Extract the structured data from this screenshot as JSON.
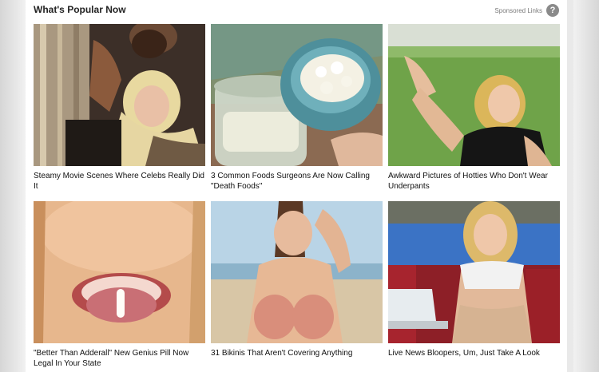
{
  "header": {
    "title": "What's Popular Now",
    "sponsored_label": "Sponsored Links",
    "help_icon": "?"
  },
  "cards": [
    {
      "caption": "Steamy Movie Scenes Where Celebs Really Did It",
      "image": "movie-scene-thumbnail"
    },
    {
      "caption": "3 Common Foods Surgeons Are Now Calling \"Death Foods\"",
      "image": "food-jar-bowl-thumbnail"
    },
    {
      "caption": "Awkward Pictures of Hotties Who Don't Wear Underpants",
      "image": "woman-on-grass-thumbnail"
    },
    {
      "caption": "\"Better Than Adderall\" New Genius Pill Now Legal In Your State",
      "image": "pill-on-tongue-thumbnail"
    },
    {
      "caption": "31 Bikinis That Aren't Covering Anything",
      "image": "beach-bikini-thumbnail"
    },
    {
      "caption": "Live News Bloopers, Um, Just Take A Look",
      "image": "news-studio-thumbnail"
    }
  ],
  "colors": {
    "background": "#e9e9e9",
    "widget": "#ffffff",
    "help_icon": "#8a8a8a"
  }
}
